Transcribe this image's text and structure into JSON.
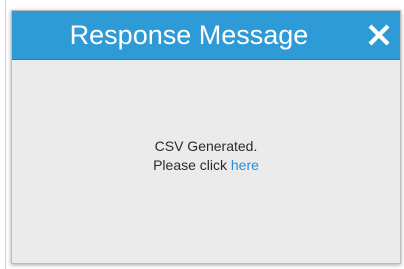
{
  "dialog": {
    "title": "Response Message",
    "close_icon": "close-icon",
    "message_line1": "CSV Generated.",
    "message_line2_prefix": "Please click",
    "link_text": "here"
  },
  "colors": {
    "header_bg": "#2e9bd7",
    "body_bg": "#ebebeb",
    "link": "#2d8fd2",
    "text": "#2b2b2b"
  }
}
